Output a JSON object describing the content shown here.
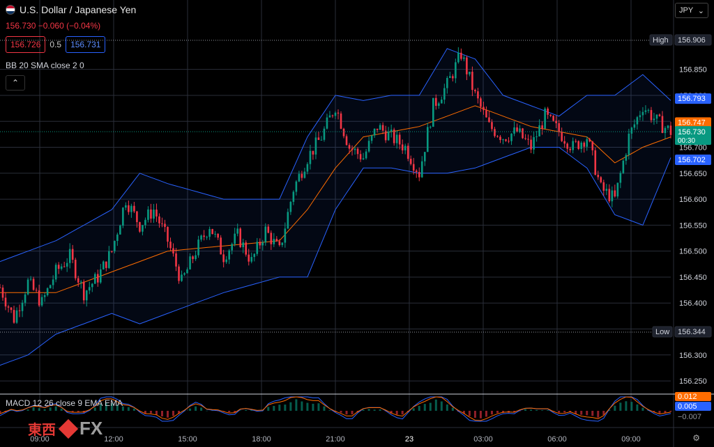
{
  "header": {
    "symbol_title": "U.S. Dollar / Japanese Yen",
    "quote": "156.730 −0.060 (−0.04%)",
    "sell_price": "156.726",
    "spread": "0.5",
    "buy_price": "156.731",
    "indicator_bb": "BB 20 SMA close 2 0",
    "indicator_macd": "MACD 12 26 close 9 EMA EMA",
    "currency": "JPY",
    "collapse_icon": "chevron-up-icon"
  },
  "logo": {
    "brand_cn": "東西",
    "brand_fx": "FX"
  },
  "chart_data": {
    "type": "candlestick",
    "ylim": [
      156.23,
      156.93
    ],
    "y_ticks": [
      "156.906",
      "156.850",
      "156.800",
      "156.750",
      "156.700",
      "156.650",
      "156.600",
      "156.550",
      "156.500",
      "156.450",
      "156.400",
      "156.350",
      "156.300",
      "156.250"
    ],
    "x_ticks": [
      "09:00",
      "12:00",
      "15:00",
      "18:00",
      "21:00",
      "23",
      "03:00",
      "06:00",
      "09:00"
    ],
    "close_path": [
      [
        0,
        156.43
      ],
      [
        5,
        156.37
      ],
      [
        10,
        156.44
      ],
      [
        15,
        156.4
      ],
      [
        20,
        156.46
      ],
      [
        25,
        156.49
      ],
      [
        30,
        156.42
      ],
      [
        35,
        156.45
      ],
      [
        40,
        156.5
      ],
      [
        45,
        156.6
      ],
      [
        50,
        156.55
      ],
      [
        55,
        156.58
      ],
      [
        60,
        156.52
      ],
      [
        65,
        156.44
      ],
      [
        70,
        156.5
      ],
      [
        75,
        156.55
      ],
      [
        80,
        156.49
      ],
      [
        85,
        156.53
      ],
      [
        90,
        156.48
      ],
      [
        95,
        156.54
      ],
      [
        100,
        156.5
      ],
      [
        105,
        156.62
      ],
      [
        110,
        156.68
      ],
      [
        115,
        156.72
      ],
      [
        120,
        156.78
      ],
      [
        125,
        156.7
      ],
      [
        130,
        156.68
      ],
      [
        135,
        156.74
      ],
      [
        140,
        156.72
      ],
      [
        145,
        156.7
      ],
      [
        150,
        156.65
      ],
      [
        155,
        156.78
      ],
      [
        160,
        156.82
      ],
      [
        165,
        156.88
      ],
      [
        170,
        156.8
      ],
      [
        175,
        156.74
      ],
      [
        180,
        156.72
      ],
      [
        185,
        156.73
      ],
      [
        190,
        156.7
      ],
      [
        195,
        156.76
      ],
      [
        200,
        156.73
      ],
      [
        205,
        156.7
      ],
      [
        210,
        156.72
      ],
      [
        215,
        156.62
      ],
      [
        220,
        156.6
      ],
      [
        225,
        156.72
      ],
      [
        230,
        156.78
      ],
      [
        235,
        156.75
      ],
      [
        240,
        156.73
      ]
    ],
    "ma_path": [
      [
        0,
        156.42
      ],
      [
        20,
        156.42
      ],
      [
        40,
        156.46
      ],
      [
        60,
        156.5
      ],
      [
        80,
        156.51
      ],
      [
        100,
        156.52
      ],
      [
        110,
        156.58
      ],
      [
        120,
        156.66
      ],
      [
        130,
        156.72
      ],
      [
        140,
        156.73
      ],
      [
        150,
        156.74
      ],
      [
        160,
        156.76
      ],
      [
        170,
        156.78
      ],
      [
        180,
        156.76
      ],
      [
        190,
        156.74
      ],
      [
        200,
        156.73
      ],
      [
        210,
        156.72
      ],
      [
        220,
        156.67
      ],
      [
        230,
        156.7
      ],
      [
        240,
        156.72
      ]
    ],
    "bb_upper_path": [
      [
        0,
        156.48
      ],
      [
        20,
        156.52
      ],
      [
        40,
        156.58
      ],
      [
        50,
        156.65
      ],
      [
        60,
        156.63
      ],
      [
        80,
        156.6
      ],
      [
        100,
        156.6
      ],
      [
        110,
        156.72
      ],
      [
        120,
        156.8
      ],
      [
        130,
        156.79
      ],
      [
        140,
        156.8
      ],
      [
        150,
        156.8
      ],
      [
        160,
        156.89
      ],
      [
        170,
        156.87
      ],
      [
        180,
        156.8
      ],
      [
        190,
        156.78
      ],
      [
        200,
        156.76
      ],
      [
        210,
        156.8
      ],
      [
        220,
        156.8
      ],
      [
        230,
        156.84
      ],
      [
        240,
        156.79
      ]
    ],
    "bb_lower_path": [
      [
        0,
        156.28
      ],
      [
        10,
        156.3
      ],
      [
        20,
        156.34
      ],
      [
        40,
        156.38
      ],
      [
        50,
        156.36
      ],
      [
        60,
        156.38
      ],
      [
        80,
        156.42
      ],
      [
        100,
        156.45
      ],
      [
        110,
        156.45
      ],
      [
        120,
        156.58
      ],
      [
        130,
        156.66
      ],
      [
        140,
        156.66
      ],
      [
        150,
        156.65
      ],
      [
        160,
        156.65
      ],
      [
        170,
        156.66
      ],
      [
        180,
        156.68
      ],
      [
        190,
        156.7
      ],
      [
        200,
        156.7
      ],
      [
        210,
        156.66
      ],
      [
        220,
        156.57
      ],
      [
        230,
        156.55
      ],
      [
        240,
        156.68
      ]
    ],
    "markers": {
      "high": {
        "label": "High",
        "value": "156.906",
        "y": 156.906
      },
      "low": {
        "label": "Low",
        "value": "156.344",
        "y": 156.344
      },
      "bb_upper": {
        "value": "156.793",
        "y": 156.793,
        "color": "#2962ff"
      },
      "bb_basis": {
        "value": "156.747",
        "y": 156.747,
        "color": "#ff6d00"
      },
      "last": {
        "value": "156.730",
        "countdown": "00:30",
        "y": 156.73,
        "color": "#089981"
      },
      "bb_lower": {
        "value": "156.702",
        "y": 156.702,
        "color": "#2962ff"
      }
    },
    "macd": {
      "labels": [
        "0.012",
        "0.005",
        "−0.007"
      ],
      "colors": [
        "#ff6d00",
        "#2962ff",
        "#9598a1"
      ]
    },
    "colors": {
      "up": "#089981",
      "down": "#f23645",
      "ma": "#ff6d00",
      "band": "#2962ff",
      "grid": "#2a2e39"
    }
  }
}
